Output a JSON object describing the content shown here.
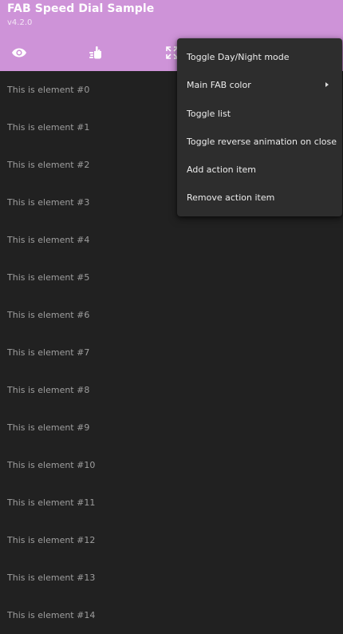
{
  "app_bar": {
    "title": "FAB Speed Dial Sample",
    "subtitle": "v4.2.0",
    "background_color": "#ce93d8",
    "actions": [
      {
        "icon": "eye-icon"
      },
      {
        "icon": "hand-pointer-icon"
      },
      {
        "icon": "expand-icon"
      }
    ]
  },
  "list": {
    "items": [
      "This is element #0",
      "This is element #1",
      "This is element #2",
      "This is element #3",
      "This is element #4",
      "This is element #5",
      "This is element #6",
      "This is element #7",
      "This is element #8",
      "This is element #9",
      "This is element #10",
      "This is element #11",
      "This is element #12",
      "This is element #13",
      "This is element #14"
    ]
  },
  "overflow_menu": {
    "items": [
      {
        "label": "Toggle Day/Night mode"
      },
      {
        "label": "Main FAB color",
        "icon": "chevron-right-icon"
      },
      {
        "label": "Toggle list"
      },
      {
        "label": "Toggle reverse animation on close"
      },
      {
        "label": "Add action item"
      },
      {
        "label": "Remove action item"
      }
    ]
  },
  "theme": {
    "background": "#212121",
    "menu_background": "#2d2d2d"
  }
}
